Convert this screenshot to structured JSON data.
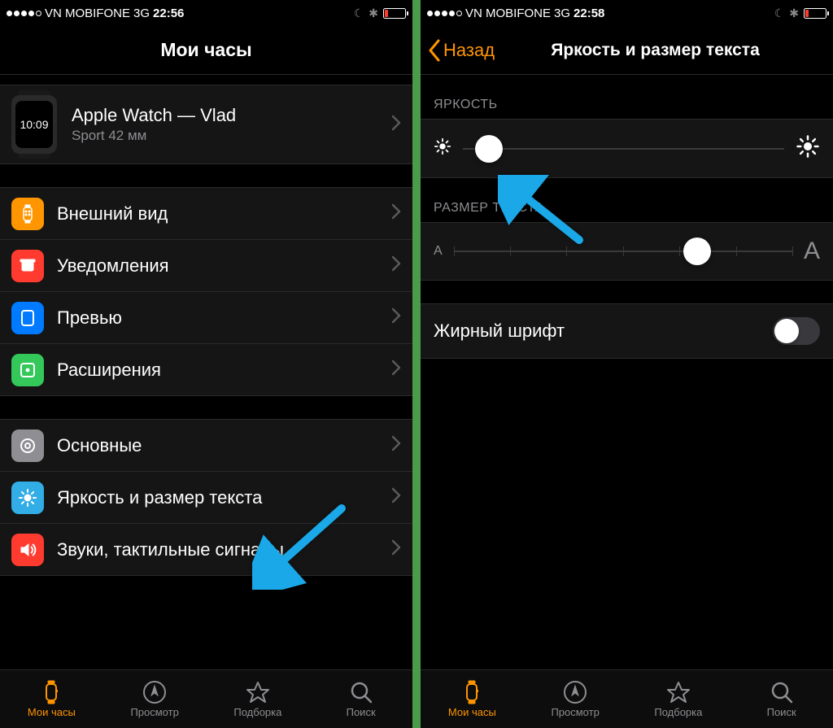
{
  "left": {
    "status": {
      "carrier": "VN MOBIFONE",
      "network": "3G",
      "time": "22:56"
    },
    "nav": {
      "title": "Мои часы"
    },
    "device": {
      "name": "Apple Watch — Vlad",
      "model": "Sport 42 мм",
      "face_time": "10:09"
    },
    "groups": [
      {
        "items": [
          {
            "icon": "watch-layout-icon",
            "color": "ic-orange",
            "label": "Внешний вид"
          },
          {
            "icon": "bell-icon",
            "color": "ic-red",
            "label": "Уведомления"
          },
          {
            "icon": "preview-icon",
            "color": "ic-blue",
            "label": "Превью"
          },
          {
            "icon": "extension-icon",
            "color": "ic-green",
            "label": "Расширения"
          }
        ]
      },
      {
        "items": [
          {
            "icon": "gear-icon",
            "color": "ic-gray",
            "label": "Основные"
          },
          {
            "icon": "brightness-icon",
            "color": "ic-lightblue",
            "label": "Яркость и размер текста"
          },
          {
            "icon": "speaker-icon",
            "color": "ic-red2",
            "label": "Звуки, тактильные сигналы"
          }
        ]
      }
    ],
    "tabs": [
      {
        "label": "Мои часы",
        "active": true
      },
      {
        "label": "Просмотр",
        "active": false
      },
      {
        "label": "Подборка",
        "active": false
      },
      {
        "label": "Поиск",
        "active": false
      }
    ]
  },
  "right": {
    "status": {
      "carrier": "VN MOBIFONE",
      "network": "3G",
      "time": "22:58"
    },
    "nav": {
      "back": "Назад",
      "title": "Яркость и размер текста"
    },
    "sections": {
      "brightness": {
        "label": "ЯРКОСТЬ",
        "value_pct": 8
      },
      "textsize": {
        "label": "РАЗМЕР ТЕКСТА",
        "small": "A",
        "large": "A",
        "value_pct": 72,
        "steps": 6
      },
      "bold": {
        "label": "Жирный шрифт",
        "on": false
      }
    },
    "tabs": [
      {
        "label": "Мои часы",
        "active": true
      },
      {
        "label": "Просмотр",
        "active": false
      },
      {
        "label": "Подборка",
        "active": false
      },
      {
        "label": "Поиск",
        "active": false
      }
    ]
  }
}
